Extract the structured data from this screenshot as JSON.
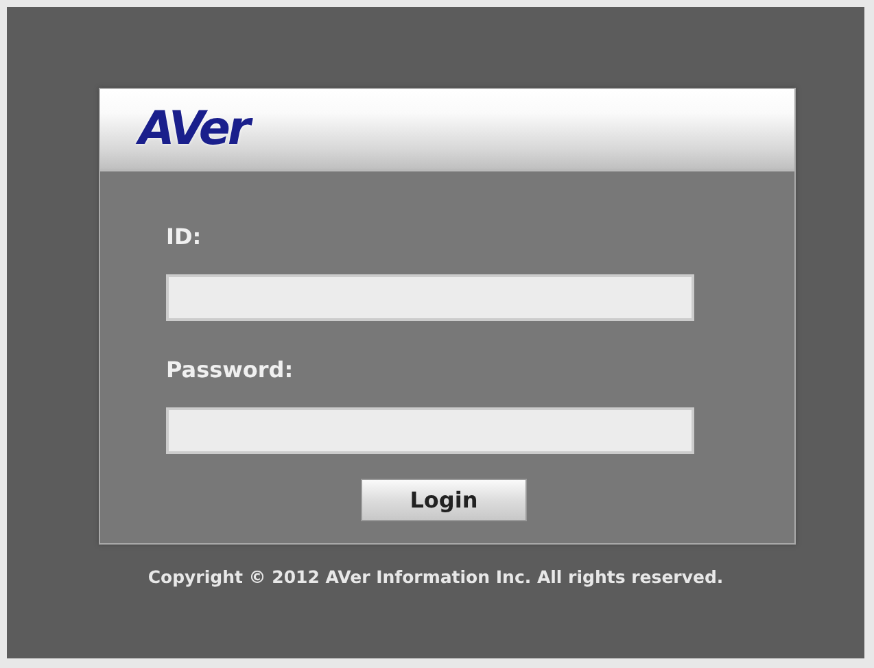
{
  "logo": "AVer",
  "fields": [
    {
      "label": "ID:"
    },
    {
      "label": "Password:"
    }
  ],
  "button": "Login",
  "copyright": "Copyright © 2012 AVer Information Inc. All rights reserved."
}
